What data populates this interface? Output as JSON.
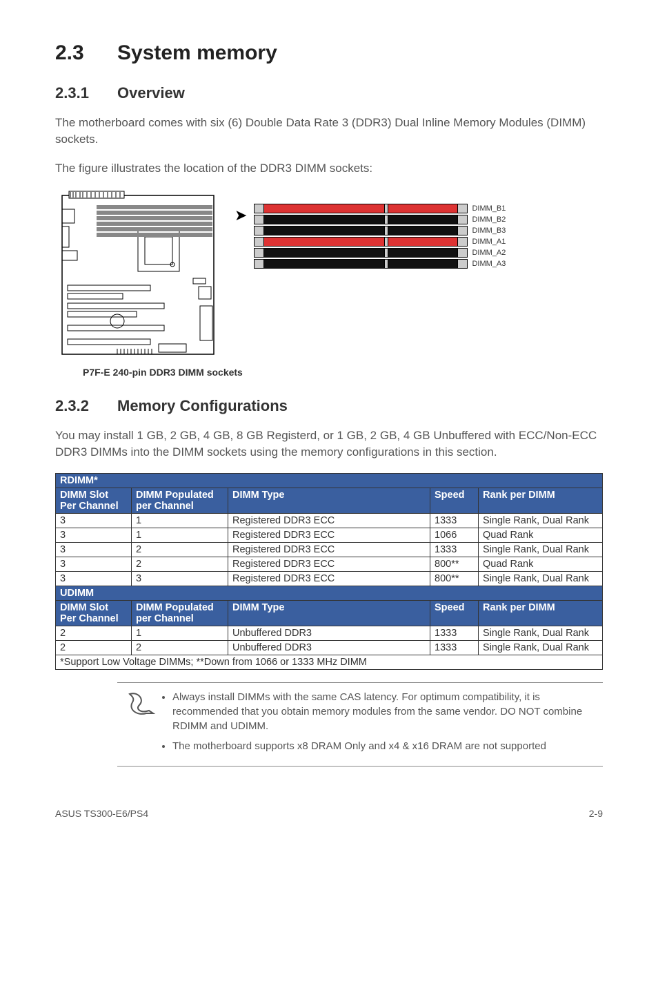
{
  "heading": {
    "number": "2.3",
    "title": "System memory"
  },
  "section1": {
    "number": "2.3.1",
    "title": "Overview",
    "para1": "The motherboard comes with six (6) Double Data Rate 3 (DDR3) Dual Inline Memory Modules (DIMM) sockets.",
    "para2": "The figure illustrates the location of the DDR3 DIMM sockets:",
    "slots": [
      "DIMM_B1",
      "DIMM_B2",
      "DIMM_B3",
      "DIMM_A1",
      "DIMM_A2",
      "DIMM_A3"
    ],
    "slot_colors": [
      "red",
      "black",
      "black",
      "red",
      "black",
      "black"
    ],
    "caption": "P7F-E 240-pin DDR3 DIMM sockets"
  },
  "section2": {
    "number": "2.3.2",
    "title": "Memory Configurations",
    "para": "You may install 1 GB, 2 GB, 4 GB, 8 GB Registerd, or 1 GB, 2 GB, 4 GB Unbuffered with ECC/Non-ECC DDR3 DIMMs into the DIMM sockets using the memory configurations in this section."
  },
  "table": {
    "rdimm_label": "RDIMM*",
    "udimm_label": "UDIMM",
    "headers": {
      "c1": "DIMM Slot Per Channel",
      "c2": "DIMM Populated per Channel",
      "c3": "DIMM Type",
      "c4": "Speed",
      "c5": "Rank per DIMM"
    },
    "rdimm_rows": [
      {
        "c1": "3",
        "c2": "1",
        "c3": "Registered DDR3 ECC",
        "c4": "1333",
        "c5": "Single Rank, Dual Rank"
      },
      {
        "c1": "3",
        "c2": "1",
        "c3": "Registered DDR3 ECC",
        "c4": "1066",
        "c5": "Quad Rank"
      },
      {
        "c1": "3",
        "c2": "2",
        "c3": "Registered DDR3 ECC",
        "c4": "1333",
        "c5": "Single Rank, Dual Rank"
      },
      {
        "c1": "3",
        "c2": "2",
        "c3": "Registered DDR3 ECC",
        "c4": "800**",
        "c5": "Quad Rank"
      },
      {
        "c1": "3",
        "c2": "3",
        "c3": "Registered DDR3 ECC",
        "c4": "800**",
        "c5": "Single Rank, Dual Rank"
      }
    ],
    "udimm_rows": [
      {
        "c1": "2",
        "c2": "1",
        "c3": "Unbuffered DDR3",
        "c4": "1333",
        "c5": "Single Rank, Dual Rank"
      },
      {
        "c1": "2",
        "c2": "2",
        "c3": "Unbuffered DDR3",
        "c4": "1333",
        "c5": "Single Rank, Dual Rank"
      }
    ],
    "footnote": "*Support Low Voltage DIMMs; **Down from 1066 or 1333 MHz DIMM"
  },
  "notes": {
    "items": [
      "Always install DIMMs with the same CAS latency. For optimum compatibility, it is recommended that you obtain memory modules from the same vendor. DO NOT combine RDIMM and UDIMM.",
      "The motherboard supports x8 DRAM Only and x4 & x16 DRAM are not supported"
    ]
  },
  "footer": {
    "left": "ASUS TS300-E6/PS4",
    "right": "2-9"
  }
}
